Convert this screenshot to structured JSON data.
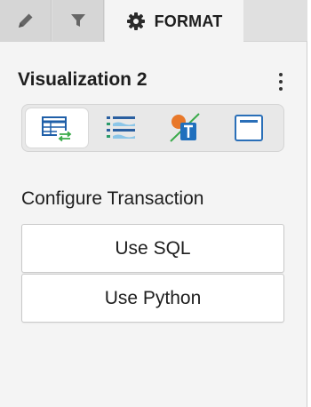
{
  "tabs": {
    "edit_icon": "pencil-icon",
    "filter_icon": "filter-icon",
    "format": {
      "icon": "gear-icon",
      "label": "FORMAT"
    }
  },
  "header": {
    "title": "Visualization 2",
    "menu_icon": "more-vertical-icon"
  },
  "viz_types": [
    {
      "icon": "table-transaction-icon",
      "active": true
    },
    {
      "icon": "list-wave-icon",
      "active": false
    },
    {
      "icon": "text-overlay-icon",
      "active": false
    },
    {
      "icon": "card-frame-icon",
      "active": false
    }
  ],
  "configure": {
    "title": "Configure Transaction",
    "buttons": [
      {
        "label": "Use SQL"
      },
      {
        "label": "Use Python"
      }
    ]
  },
  "colors": {
    "accent_blue": "#1f6fbd",
    "accent_green": "#3aaa4a",
    "accent_orange": "#e8782a",
    "panel_bg": "#f4f4f4",
    "tab_bg": "#d6d6d6"
  }
}
